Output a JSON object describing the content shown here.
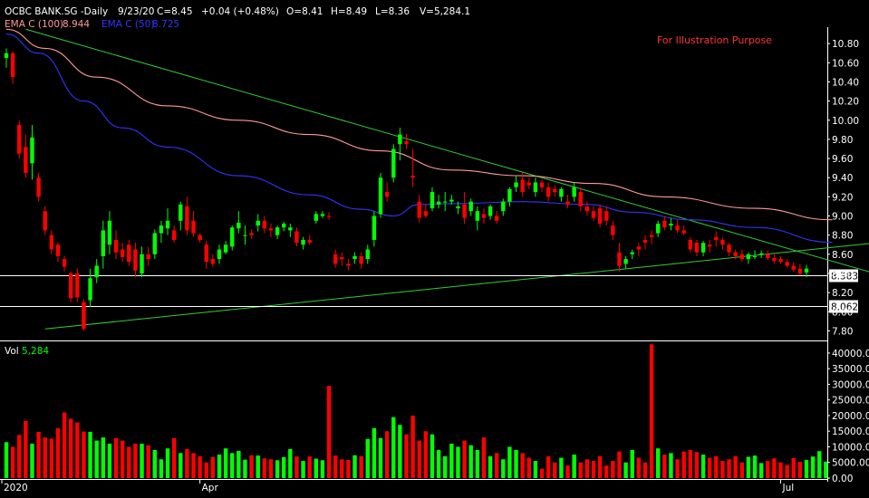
{
  "header": {
    "symbol": "OCBC BANK.SG -Daily",
    "date": "9/23/20",
    "close": "C=8.45",
    "change": "+0.04 (+0.48%)",
    "open": "O=8.41",
    "high": "H=8.49",
    "low": "L=8.36",
    "volume": "V=5,284.1"
  },
  "ema_legend": {
    "ema100_label": "EMA C (100)",
    "ema100_value": "8.944",
    "ema50_label": "EMA C (50)",
    "ema50_value": "8.725"
  },
  "annotation": "For Illustration Purpose",
  "volume_legend": {
    "label": "Vol",
    "value": "5,284"
  },
  "levels": [
    {
      "label": "8.383",
      "value": 8.383
    },
    {
      "label": "8.062",
      "value": 8.062
    }
  ],
  "colors": {
    "background": "#000000",
    "up": "#00ff00",
    "down": "#ff0000",
    "ema100": "#ff9999",
    "ema50": "#3333ff",
    "trendline": "#33cc33",
    "annotation": "#ff3333",
    "volume_label": "#00ff00"
  },
  "chart_data": [
    {
      "type": "candlestick",
      "title": "OCBC BANK.SG -Daily",
      "x_tick_labels": [
        "2020",
        "Apr",
        "Jul"
      ],
      "y_tick_labels": [
        "7.80",
        "8.00",
        "8.20",
        "8.40",
        "8.60",
        "8.80",
        "9.00",
        "9.20",
        "9.40",
        "9.60",
        "9.80",
        "10.00",
        "10.20",
        "10.40",
        "10.60",
        "10.80"
      ],
      "ylim": [
        7.7,
        11.0
      ],
      "grid": false,
      "candles": [
        [
          10.65,
          10.75,
          10.55,
          10.7
        ],
        [
          10.7,
          10.72,
          10.38,
          10.45
        ],
        [
          9.95,
          10.0,
          9.6,
          9.65
        ],
        [
          9.72,
          9.85,
          9.4,
          9.45
        ],
        [
          9.55,
          9.95,
          9.38,
          9.82
        ],
        [
          9.4,
          9.45,
          9.15,
          9.2
        ],
        [
          9.05,
          9.1,
          8.8,
          8.85
        ],
        [
          8.8,
          8.85,
          8.6,
          8.65
        ],
        [
          8.7,
          8.72,
          8.52,
          8.58
        ],
        [
          8.55,
          8.58,
          8.42,
          8.47
        ],
        [
          8.4,
          8.42,
          8.1,
          8.14
        ],
        [
          8.4,
          8.45,
          8.1,
          8.15
        ],
        [
          8.1,
          8.13,
          7.8,
          7.82
        ],
        [
          8.12,
          8.45,
          8.05,
          8.35
        ],
        [
          8.36,
          8.55,
          8.3,
          8.48
        ],
        [
          8.58,
          8.95,
          8.45,
          8.85
        ],
        [
          8.7,
          9.05,
          8.6,
          8.95
        ],
        [
          8.75,
          8.85,
          8.55,
          8.62
        ],
        [
          8.65,
          8.72,
          8.52,
          8.57
        ],
        [
          8.7,
          8.75,
          8.48,
          8.52
        ],
        [
          8.65,
          8.72,
          8.36,
          8.43
        ],
        [
          8.4,
          8.68,
          8.36,
          8.6
        ],
        [
          8.6,
          8.68,
          8.48,
          8.55
        ],
        [
          8.6,
          8.86,
          8.55,
          8.82
        ],
        [
          8.82,
          8.95,
          8.72,
          8.9
        ],
        [
          8.87,
          9.08,
          8.8,
          8.95
        ],
        [
          8.85,
          8.9,
          8.72,
          8.75
        ],
        [
          8.95,
          9.15,
          8.85,
          9.12
        ],
        [
          9.1,
          9.2,
          8.8,
          8.85
        ],
        [
          8.95,
          9.05,
          8.78,
          8.82
        ],
        [
          8.8,
          8.82,
          8.72,
          8.75
        ],
        [
          8.7,
          8.74,
          8.45,
          8.52
        ],
        [
          8.55,
          8.6,
          8.47,
          8.5
        ],
        [
          8.55,
          8.7,
          8.5,
          8.65
        ],
        [
          8.62,
          8.74,
          8.6,
          8.7
        ],
        [
          8.68,
          8.9,
          8.64,
          8.88
        ],
        [
          8.87,
          9.05,
          8.82,
          8.93
        ],
        [
          8.8,
          8.9,
          8.7,
          8.8
        ],
        [
          8.82,
          8.86,
          8.76,
          8.8
        ],
        [
          8.9,
          9.02,
          8.84,
          8.95
        ],
        [
          8.95,
          9.0,
          8.82,
          8.87
        ],
        [
          8.87,
          8.92,
          8.78,
          8.85
        ],
        [
          8.8,
          8.9,
          8.76,
          8.88
        ],
        [
          8.88,
          8.94,
          8.84,
          8.92
        ],
        [
          8.85,
          8.92,
          8.78,
          8.88
        ],
        [
          8.84,
          8.88,
          8.68,
          8.72
        ],
        [
          8.7,
          8.78,
          8.65,
          8.75
        ],
        [
          8.75,
          8.8,
          8.7,
          8.72
        ],
        [
          8.95,
          9.05,
          8.92,
          9.02
        ],
        [
          9.0,
          9.05,
          8.98,
          9.02
        ],
        [
          9.0,
          9.04,
          8.96,
          8.99
        ],
        [
          8.6,
          8.65,
          8.46,
          8.5
        ],
        [
          8.57,
          8.62,
          8.48,
          8.55
        ],
        [
          8.5,
          8.55,
          8.43,
          8.48
        ],
        [
          8.55,
          8.62,
          8.5,
          8.58
        ],
        [
          8.58,
          8.62,
          8.45,
          8.5
        ],
        [
          8.55,
          8.7,
          8.5,
          8.65
        ],
        [
          8.75,
          9.05,
          8.68,
          9.0
        ],
        [
          9.02,
          9.45,
          8.98,
          9.4
        ],
        [
          9.25,
          9.35,
          9.15,
          9.2
        ],
        [
          9.4,
          9.75,
          9.35,
          9.7
        ],
        [
          9.75,
          9.92,
          9.58,
          9.85
        ],
        [
          9.78,
          9.86,
          9.7,
          9.75
        ],
        [
          9.42,
          9.7,
          9.3,
          9.4
        ],
        [
          9.15,
          9.22,
          8.93,
          8.98
        ],
        [
          9.05,
          9.12,
          8.98,
          9.0
        ],
        [
          9.08,
          9.3,
          9.05,
          9.25
        ],
        [
          9.12,
          9.22,
          9.08,
          9.15
        ],
        [
          9.15,
          9.25,
          9.05,
          9.15
        ],
        [
          9.15,
          9.22,
          9.12,
          9.17
        ],
        [
          9.08,
          9.15,
          9.02,
          9.1
        ],
        [
          9.12,
          9.25,
          8.92,
          8.98
        ],
        [
          9.05,
          9.18,
          9.0,
          9.15
        ],
        [
          8.95,
          9.1,
          8.85,
          9.05
        ],
        [
          9.02,
          9.08,
          8.92,
          8.98
        ],
        [
          9.0,
          9.12,
          8.96,
          9.1
        ],
        [
          9.0,
          9.05,
          8.92,
          8.95
        ],
        [
          9.05,
          9.18,
          9.0,
          9.15
        ],
        [
          9.15,
          9.3,
          9.1,
          9.28
        ],
        [
          9.3,
          9.42,
          9.25,
          9.35
        ],
        [
          9.38,
          9.45,
          9.2,
          9.25
        ],
        [
          9.35,
          9.4,
          9.28,
          9.32
        ],
        [
          9.25,
          9.4,
          9.2,
          9.35
        ],
        [
          9.35,
          9.38,
          9.25,
          9.3
        ],
        [
          9.3,
          9.35,
          9.15,
          9.2
        ],
        [
          9.28,
          9.32,
          9.2,
          9.25
        ],
        [
          9.2,
          9.3,
          9.15,
          9.28
        ],
        [
          9.15,
          9.22,
          9.08,
          9.12
        ],
        [
          9.2,
          9.35,
          9.15,
          9.3
        ],
        [
          9.25,
          9.3,
          9.05,
          9.1
        ],
        [
          9.1,
          9.15,
          9.0,
          9.05
        ],
        [
          9.05,
          9.1,
          8.95,
          8.98
        ],
        [
          9.08,
          9.12,
          8.88,
          8.92
        ],
        [
          9.05,
          9.1,
          8.9,
          8.95
        ],
        [
          8.9,
          8.95,
          8.75,
          8.8
        ],
        [
          8.62,
          8.72,
          8.42,
          8.48
        ],
        [
          8.5,
          8.58,
          8.45,
          8.55
        ],
        [
          8.6,
          8.65,
          8.55,
          8.62
        ],
        [
          8.68,
          8.72,
          8.58,
          8.65
        ],
        [
          8.75,
          8.8,
          8.65,
          8.72
        ],
        [
          8.8,
          8.85,
          8.7,
          8.78
        ],
        [
          8.82,
          8.95,
          8.78,
          8.92
        ],
        [
          8.95,
          9.0,
          8.85,
          8.88
        ],
        [
          8.9,
          8.98,
          8.85,
          8.92
        ],
        [
          8.9,
          8.96,
          8.82,
          8.85
        ],
        [
          8.85,
          8.9,
          8.8,
          8.82
        ],
        [
          8.75,
          8.78,
          8.62,
          8.65
        ],
        [
          8.72,
          8.75,
          8.58,
          8.62
        ],
        [
          8.62,
          8.74,
          8.58,
          8.72
        ],
        [
          8.7,
          8.75,
          8.62,
          8.68
        ],
        [
          8.78,
          8.84,
          8.68,
          8.75
        ],
        [
          8.75,
          8.78,
          8.65,
          8.7
        ],
        [
          8.7,
          8.72,
          8.58,
          8.62
        ],
        [
          8.62,
          8.65,
          8.55,
          8.58
        ],
        [
          8.6,
          8.65,
          8.52,
          8.55
        ],
        [
          8.55,
          8.62,
          8.5,
          8.6
        ],
        [
          8.58,
          8.64,
          8.55,
          8.58
        ],
        [
          8.6,
          8.64,
          8.56,
          8.61
        ],
        [
          8.6,
          8.64,
          8.54,
          8.56
        ],
        [
          8.56,
          8.6,
          8.5,
          8.53
        ],
        [
          8.55,
          8.58,
          8.5,
          8.52
        ],
        [
          8.52,
          8.55,
          8.46,
          8.48
        ],
        [
          8.48,
          8.52,
          8.42,
          8.44
        ],
        [
          8.45,
          8.5,
          8.38,
          8.4
        ],
        [
          8.41,
          8.49,
          8.36,
          8.45
        ]
      ],
      "ema100": [
        [
          0,
          10.95
        ],
        [
          6,
          10.75
        ],
        [
          14,
          10.45
        ],
        [
          25,
          10.15
        ],
        [
          36,
          10.0
        ],
        [
          47,
          9.85
        ],
        [
          58,
          9.68
        ],
        [
          69,
          9.48
        ],
        [
          80,
          9.42
        ],
        [
          91,
          9.34
        ],
        [
          102,
          9.2
        ],
        [
          116,
          9.08
        ],
        [
          128,
          8.96
        ]
      ],
      "ema50": [
        [
          0,
          10.9
        ],
        [
          5,
          10.7
        ],
        [
          12,
          10.2
        ],
        [
          18,
          9.92
        ],
        [
          25,
          9.72
        ],
        [
          36,
          9.42
        ],
        [
          47,
          9.22
        ],
        [
          55,
          9.07
        ],
        [
          60,
          9.0
        ],
        [
          64,
          9.12
        ],
        [
          70,
          9.13
        ],
        [
          80,
          9.15
        ],
        [
          90,
          9.12
        ],
        [
          97,
          9.04
        ],
        [
          106,
          8.96
        ],
        [
          116,
          8.88
        ],
        [
          128,
          8.725
        ]
      ],
      "trendlines": [
        {
          "points": [
            [
              3,
              10.95
            ],
            [
              132,
              8.45
            ]
          ]
        },
        {
          "points": [
            [
              6,
              7.82
            ],
            [
              132,
              8.7
            ]
          ]
        }
      ]
    },
    {
      "type": "bar",
      "ylabel": "Vol",
      "y_tick_labels": [
        "0.00",
        "5000.00",
        "10000.00",
        "15000.00",
        "20000.00",
        "25000.00",
        "30000.00",
        "35000.00",
        "40000.00"
      ],
      "ylim": [
        0,
        42000
      ],
      "values": [
        11500,
        10000,
        13800,
        18300,
        11000,
        14800,
        13000,
        12600,
        16000,
        21000,
        19000,
        17800,
        14900,
        14800,
        12000,
        13000,
        11000,
        12800,
        12000,
        10000,
        11000,
        11000,
        10500,
        9000,
        6000,
        9500,
        12800,
        8000,
        9300,
        8000,
        7000,
        5000,
        6800,
        7500,
        9500,
        8000,
        8700,
        5900,
        7300,
        7200,
        6300,
        6000,
        5700,
        6700,
        9300,
        6900,
        5500,
        6900,
        6200,
        5700,
        29500,
        7200,
        6000,
        5800,
        7300,
        7000,
        12500,
        16000,
        12800,
        15000,
        19500,
        17000,
        14000,
        20000,
        12000,
        15000,
        14000,
        9000,
        7000,
        11000,
        10000,
        12000,
        10500,
        9000,
        13000,
        7000,
        8000,
        6000,
        10000,
        9000,
        8000,
        6500,
        5500,
        3000,
        7000,
        5000,
        6500,
        4000,
        7500,
        5000,
        6000,
        5500,
        7000,
        4000,
        5500,
        8500,
        5000,
        9000,
        6500,
        5000,
        42800,
        9500,
        7500,
        8000,
        6000,
        8500,
        9000,
        8300,
        7500,
        6500,
        7000,
        5500,
        6000,
        7000,
        5000,
        6800,
        7200,
        4800,
        5500,
        6300,
        5000,
        4200,
        6400,
        5200,
        5800,
        6900,
        8600,
        5284
      ]
    }
  ]
}
